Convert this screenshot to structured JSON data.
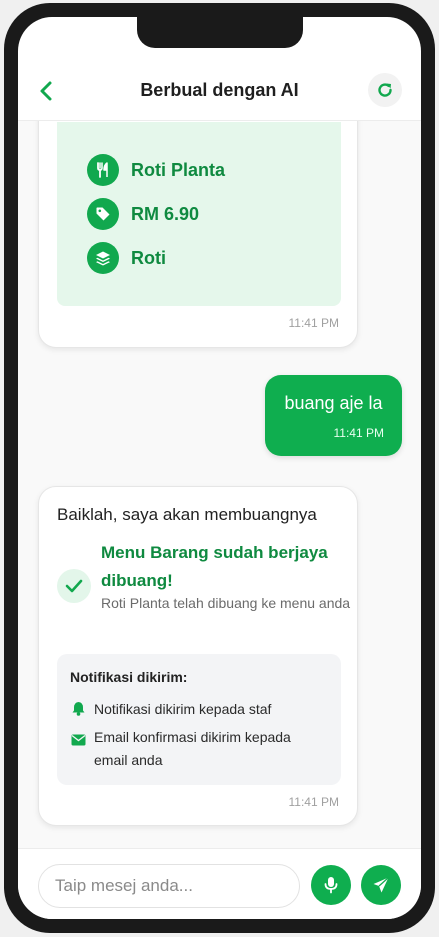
{
  "header": {
    "title": "Berbual dengan AI",
    "back_icon": "chevron-left-icon",
    "refresh_icon": "refresh-icon"
  },
  "messages": {
    "product": {
      "items": [
        {
          "icon": "utensils-icon",
          "text": "Roti Planta"
        },
        {
          "icon": "tag-icon",
          "text": "RM 6.90"
        },
        {
          "icon": "layers-icon",
          "text": "Roti"
        }
      ],
      "time": "11:41 PM"
    },
    "user": {
      "text": "buang aje la",
      "time": "11:41 PM"
    },
    "ai": {
      "intro": "Baiklah, saya akan membuangnya",
      "success_title": "Menu Barang sudah berjaya dibuang!",
      "success_sub": "Roti Planta telah dibuang ke menu anda",
      "notif_title": "Notifikasi dikirim:",
      "notifs": [
        {
          "icon": "bell-icon",
          "text": "Notifikasi dikirim kepada staf"
        },
        {
          "icon": "mail-icon",
          "text": "Email konfirmasi dikirim kepada email anda"
        }
      ],
      "time": "11:41 PM"
    }
  },
  "composer": {
    "placeholder": "Taip mesej anda...",
    "mic_icon": "microphone-icon",
    "send_icon": "send-icon"
  },
  "colors": {
    "accent": "#0fae4f",
    "accent_dark": "#0f8a40",
    "card_bg": "#e5f7eb"
  }
}
